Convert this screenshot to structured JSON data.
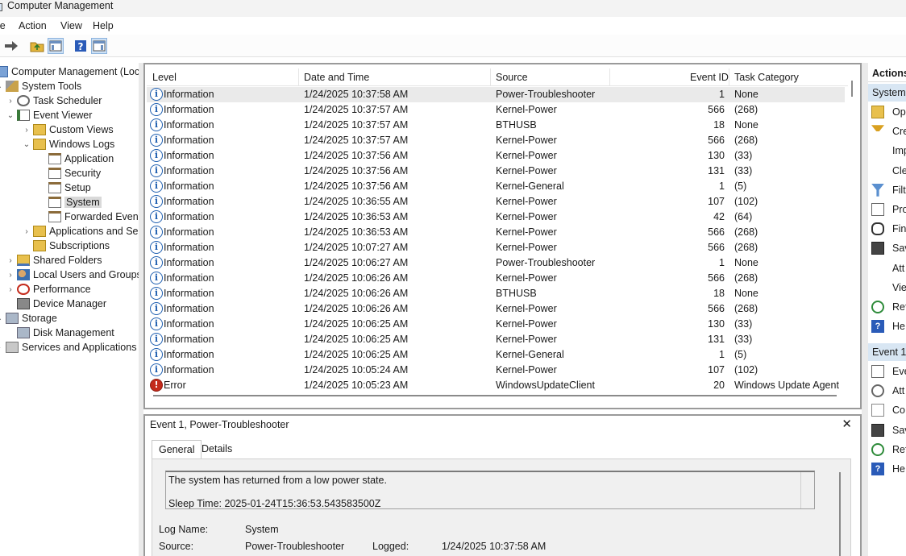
{
  "window": {
    "title": "Computer Management"
  },
  "menu": [
    "le",
    "Action",
    "View",
    "Help"
  ],
  "toolbar": {
    "buttons": [
      "back-arrow-icon",
      "up-folder-icon",
      "show-hide-tree-icon",
      "help-icon",
      "show-hide-action-pane-icon"
    ]
  },
  "tree": [
    {
      "label": "Computer Management (Local",
      "depth": 0,
      "icon": "computer-icon",
      "chev": ""
    },
    {
      "label": "System Tools",
      "depth": 1,
      "icon": "tools-icon",
      "chev": "v"
    },
    {
      "label": "Task Scheduler",
      "depth": 2,
      "icon": "clock-icon",
      "chev": ">"
    },
    {
      "label": "Event Viewer",
      "depth": 2,
      "icon": "event-viewer-icon",
      "chev": "v"
    },
    {
      "label": "Custom Views",
      "depth": 3,
      "icon": "folder-icon",
      "chev": ">"
    },
    {
      "label": "Windows Logs",
      "depth": 3,
      "icon": "folder-icon",
      "chev": "v"
    },
    {
      "label": "Application",
      "depth": 4,
      "icon": "log-icon",
      "chev": ""
    },
    {
      "label": "Security",
      "depth": 4,
      "icon": "log-icon",
      "chev": ""
    },
    {
      "label": "Setup",
      "depth": 4,
      "icon": "log-icon",
      "chev": ""
    },
    {
      "label": "System",
      "depth": 4,
      "icon": "log-icon",
      "chev": "",
      "selected": true
    },
    {
      "label": "Forwarded Events",
      "depth": 4,
      "icon": "log-icon",
      "chev": ""
    },
    {
      "label": "Applications and Se",
      "depth": 3,
      "icon": "folder-icon",
      "chev": ">"
    },
    {
      "label": "Subscriptions",
      "depth": 3,
      "icon": "subscriptions-icon",
      "chev": ""
    },
    {
      "label": "Shared Folders",
      "depth": 2,
      "icon": "shared-folder-icon",
      "chev": ">"
    },
    {
      "label": "Local Users and Groups",
      "depth": 2,
      "icon": "users-icon",
      "chev": ">"
    },
    {
      "label": "Performance",
      "depth": 2,
      "icon": "performance-icon",
      "chev": ">"
    },
    {
      "label": "Device Manager",
      "depth": 2,
      "icon": "device-manager-icon",
      "chev": ""
    },
    {
      "label": "Storage",
      "depth": 1,
      "icon": "storage-icon",
      "chev": "v"
    },
    {
      "label": "Disk Management",
      "depth": 2,
      "icon": "disk-icon",
      "chev": ""
    },
    {
      "label": "Services and Applications",
      "depth": 1,
      "icon": "services-icon",
      "chev": ">"
    }
  ],
  "grid": {
    "columns": [
      "Level",
      "Date and Time",
      "Source",
      "Event ID",
      "Task Category"
    ],
    "rows": [
      {
        "level": "Information",
        "date": "1/24/2025 10:37:58 AM",
        "source": "Power-Troubleshooter",
        "id": "1",
        "cat": "None"
      },
      {
        "level": "Information",
        "date": "1/24/2025 10:37:57 AM",
        "source": "Kernel-Power",
        "id": "566",
        "cat": "(268)"
      },
      {
        "level": "Information",
        "date": "1/24/2025 10:37:57 AM",
        "source": "BTHUSB",
        "id": "18",
        "cat": "None"
      },
      {
        "level": "Information",
        "date": "1/24/2025 10:37:57 AM",
        "source": "Kernel-Power",
        "id": "566",
        "cat": "(268)"
      },
      {
        "level": "Information",
        "date": "1/24/2025 10:37:56 AM",
        "source": "Kernel-Power",
        "id": "130",
        "cat": "(33)"
      },
      {
        "level": "Information",
        "date": "1/24/2025 10:37:56 AM",
        "source": "Kernel-Power",
        "id": "131",
        "cat": "(33)"
      },
      {
        "level": "Information",
        "date": "1/24/2025 10:37:56 AM",
        "source": "Kernel-General",
        "id": "1",
        "cat": "(5)"
      },
      {
        "level": "Information",
        "date": "1/24/2025 10:36:55 AM",
        "source": "Kernel-Power",
        "id": "107",
        "cat": "(102)"
      },
      {
        "level": "Information",
        "date": "1/24/2025 10:36:53 AM",
        "source": "Kernel-Power",
        "id": "42",
        "cat": "(64)"
      },
      {
        "level": "Information",
        "date": "1/24/2025 10:36:53 AM",
        "source": "Kernel-Power",
        "id": "566",
        "cat": "(268)"
      },
      {
        "level": "Information",
        "date": "1/24/2025 10:07:27 AM",
        "source": "Kernel-Power",
        "id": "566",
        "cat": "(268)"
      },
      {
        "level": "Information",
        "date": "1/24/2025 10:06:27 AM",
        "source": "Power-Troubleshooter",
        "id": "1",
        "cat": "None"
      },
      {
        "level": "Information",
        "date": "1/24/2025 10:06:26 AM",
        "source": "Kernel-Power",
        "id": "566",
        "cat": "(268)"
      },
      {
        "level": "Information",
        "date": "1/24/2025 10:06:26 AM",
        "source": "BTHUSB",
        "id": "18",
        "cat": "None"
      },
      {
        "level": "Information",
        "date": "1/24/2025 10:06:26 AM",
        "source": "Kernel-Power",
        "id": "566",
        "cat": "(268)"
      },
      {
        "level": "Information",
        "date": "1/24/2025 10:06:25 AM",
        "source": "Kernel-Power",
        "id": "130",
        "cat": "(33)"
      },
      {
        "level": "Information",
        "date": "1/24/2025 10:06:25 AM",
        "source": "Kernel-Power",
        "id": "131",
        "cat": "(33)"
      },
      {
        "level": "Information",
        "date": "1/24/2025 10:06:25 AM",
        "source": "Kernel-General",
        "id": "1",
        "cat": "(5)"
      },
      {
        "level": "Information",
        "date": "1/24/2025 10:05:24 AM",
        "source": "Kernel-Power",
        "id": "107",
        "cat": "(102)"
      },
      {
        "level": "Error",
        "date": "1/24/2025 10:05:23 AM",
        "source": "WindowsUpdateClient",
        "id": "20",
        "cat": "Windows Update Agent"
      }
    ]
  },
  "detail": {
    "title": "Event 1, Power-Troubleshooter",
    "close": "✕",
    "tabs": [
      "General",
      "Details"
    ],
    "message_line1": "The system has returned from a low power state.",
    "message_line2": "Sleep Time: 2025-01-24T15:36:53.543583500Z",
    "log_name_label": "Log Name:",
    "log_name": "System",
    "source_label": "Source:",
    "source": "Power-Troubleshooter",
    "logged_label": "Logged:",
    "logged": "1/24/2025 10:37:58 AM"
  },
  "actions": {
    "header": "Actions",
    "group1": "System",
    "items1": [
      {
        "label": "Op",
        "icon": "open-folder-icon"
      },
      {
        "label": "Cre",
        "icon": "create-filter-icon"
      },
      {
        "label": "Imp",
        "icon": ""
      },
      {
        "label": "Cle",
        "icon": ""
      },
      {
        "label": "Filt",
        "icon": "filter-icon"
      },
      {
        "label": "Pro",
        "icon": "properties-icon"
      },
      {
        "label": "Fin",
        "icon": "find-icon"
      },
      {
        "label": "Sav",
        "icon": "save-icon"
      },
      {
        "label": "Att",
        "icon": ""
      },
      {
        "label": "Vie",
        "icon": ""
      },
      {
        "label": "Ref",
        "icon": "refresh-icon"
      },
      {
        "label": "He",
        "icon": "help-icon"
      }
    ],
    "group2": "Event 1,",
    "items2": [
      {
        "label": "Eve",
        "icon": "event-properties-icon"
      },
      {
        "label": "Att",
        "icon": "attach-task-icon"
      },
      {
        "label": "Co",
        "icon": "copy-icon"
      },
      {
        "label": "Sav",
        "icon": "save-icon"
      },
      {
        "label": "Ref",
        "icon": "refresh-icon"
      },
      {
        "label": "He",
        "icon": "help-icon"
      }
    ]
  }
}
